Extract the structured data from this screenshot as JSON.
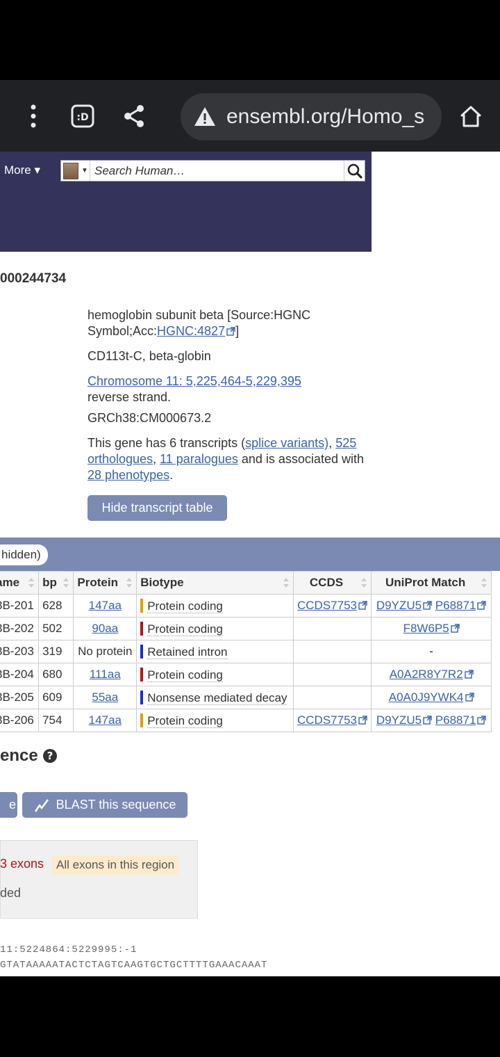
{
  "browser": {
    "url": "ensembl.org/Homo_s",
    "icons": [
      "more-vert-icon",
      "desktop-site-icon",
      "share-icon",
      "warning-icon",
      "home-icon"
    ]
  },
  "masthead": {
    "more_label": "More ▾",
    "search_placeholder": "Search Human…"
  },
  "gene": {
    "id_fragment": "000244734",
    "description_pre": "hemoglobin subunit beta [Source:HGNC Symbol;Acc:",
    "hgnc_link": "HGNC:4827",
    "description_post": "]",
    "synonyms": "CD113t-C, beta-globin",
    "location_link": "Chromosome 11: 5,225,464-5,229,395",
    "strand": " reverse strand.",
    "assembly": "GRCh38:CM000673.2",
    "transcripts_text_1": "This gene has 6 transcripts (",
    "splice_link": "splice variants)",
    "transcripts_text_2": ",",
    "orthologues_link": "525 orthologues",
    "comma": ",",
    "paralogues_link": "11 paralogues",
    "transcripts_text_3": " and is associated with ",
    "phenotypes_link": "28 phenotypes",
    "period": ".",
    "hide_button": "Hide transcript table"
  },
  "table": {
    "hidden_label": "hidden)",
    "headers": [
      "ame",
      "bp",
      "Protein",
      "Biotype",
      "CCDS",
      "UniProt Match"
    ],
    "rows": [
      {
        "name": "3B-201",
        "bp": "628",
        "protein": "147aa",
        "biotype": "Protein coding",
        "biotype_color": "#e0a000",
        "ccds": "CCDS7753",
        "uniprot1": "D9YZU5",
        "uniprot2": "P68871"
      },
      {
        "name": "3B-202",
        "bp": "502",
        "protein": "90aa",
        "biotype": "Protein coding",
        "biotype_color": "#b01616",
        "ccds": "",
        "uniprot1": "F8W6P5",
        "uniprot2": ""
      },
      {
        "name": "3B-203",
        "bp": "319",
        "protein": "No protein",
        "biotype": "Retained intron",
        "biotype_color": "#1c2bcc",
        "ccds": "",
        "uniprot1": "-",
        "uniprot2": ""
      },
      {
        "name": "3B-204",
        "bp": "680",
        "protein": "111aa",
        "biotype": "Protein coding",
        "biotype_color": "#b01616",
        "ccds": "",
        "uniprot1": "A0A2R8Y7R2",
        "uniprot2": ""
      },
      {
        "name": "3B-205",
        "bp": "609",
        "protein": "55aa",
        "biotype": "Nonsense mediated decay",
        "biotype_color": "#1c2bcc",
        "ccds": "",
        "uniprot1": "A0A0J9YWK4",
        "uniprot2": ""
      },
      {
        "name": "3B-206",
        "bp": "754",
        "protein": "147aa",
        "biotype": "Protein coding",
        "biotype_color": "#e0a000",
        "ccds": "CCDS7753",
        "uniprot1": "D9YZU5",
        "uniprot2": "P68871"
      }
    ]
  },
  "sequence": {
    "title_fragment": "ence",
    "prev_button_fragment": "e",
    "blast_button": "BLAST this sequence",
    "exons_label": "3 exons",
    "exons_region": "All exons in this region",
    "excluded_fragment": "ded",
    "header_line": "11:5224864:5229995:-1",
    "seq_line": "GTATAAAAATACTCTAGTCAAGTGCTGCTTTTGAAACAAAT"
  }
}
